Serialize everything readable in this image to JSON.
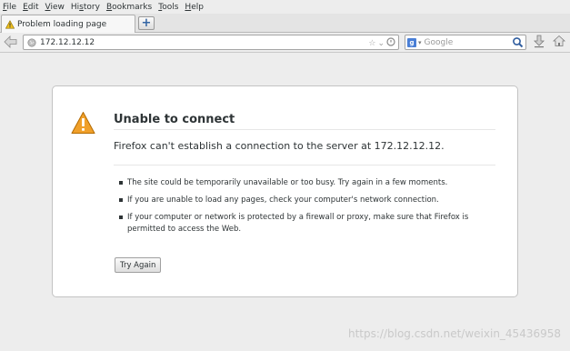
{
  "menubar": {
    "items": [
      {
        "accel": "F",
        "rest": "ile"
      },
      {
        "accel": "E",
        "rest": "dit"
      },
      {
        "accel": "V",
        "rest": "iew"
      },
      {
        "pre": "Hi",
        "accel": "s",
        "rest": "tory"
      },
      {
        "accel": "B",
        "rest": "ookmarks"
      },
      {
        "accel": "T",
        "rest": "ools"
      },
      {
        "accel": "H",
        "rest": "elp"
      }
    ]
  },
  "tab": {
    "title": "Problem loading page",
    "new_tab_symbol": "+"
  },
  "navbar": {
    "url": "172.12.12.12",
    "search_placeholder": "Google",
    "search_engine_letter": "g"
  },
  "error": {
    "title": "Unable to connect",
    "short_desc": "Firefox can't establish a connection to the server at 172.12.12.12.",
    "bullets": [
      "The site could be temporarily unavailable or too busy. Try again in a few moments.",
      "If you are unable to load any pages, check your computer's network connection.",
      "If your computer or network is protected by a firewall or proxy, make sure that Firefox is permitted to access the Web."
    ],
    "try_again_label": "Try Again"
  },
  "watermark": "https://blog.csdn.net/weixin_45436958",
  "colors": {
    "warning": "#f0a02a",
    "accent": "#3465a4"
  },
  "icons": [
    "back-icon",
    "globe-icon",
    "star-icon",
    "dropdown-icon",
    "reload-icon",
    "search-engine-icon",
    "magnifier-icon",
    "download-icon",
    "home-icon",
    "warning-icon"
  ]
}
